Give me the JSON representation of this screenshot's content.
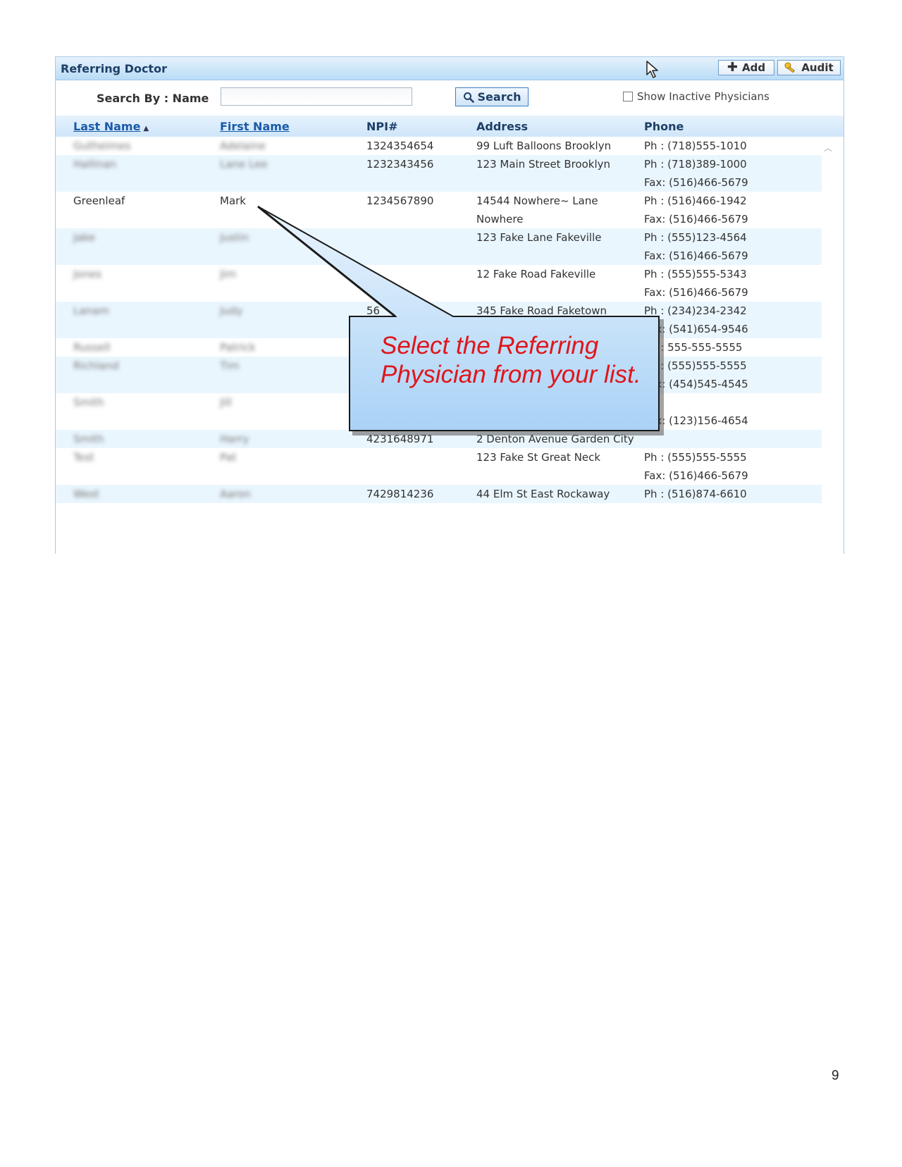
{
  "panel": {
    "title": "Referring Doctor",
    "add_label": "Add",
    "audit_label": "Audit"
  },
  "search": {
    "label": "Search By : Name",
    "value": "",
    "button_label": "Search",
    "inactive_label": "Show Inactive Physicians"
  },
  "table": {
    "headers": {
      "last_name": "Last Name",
      "first_name": "First Name",
      "npi": "NPI#",
      "address": "Address",
      "phone": "Phone"
    },
    "rows": [
      {
        "last": "Gutheimes",
        "first": "Adelaine",
        "npi": "1324354654",
        "address": [
          "99 Luft Balloons Brooklyn"
        ],
        "phone": [
          "Ph : (718)555-1010"
        ]
      },
      {
        "last": "Hallinan",
        "first": "Lane Lee",
        "npi": "1232343456",
        "address": [
          "123 Main Street Brooklyn"
        ],
        "phone": [
          "Ph : (718)389-1000",
          "Fax: (516)466-5679"
        ]
      },
      {
        "last": "Greenleaf",
        "first": "Mark",
        "npi": "1234567890",
        "address": [
          "14544 Nowhere~ Lane",
          "Nowhere"
        ],
        "phone": [
          "Ph : (516)466-1942",
          "Fax: (516)466-5679"
        ]
      },
      {
        "last": "Jake",
        "first": "Justin",
        "npi": "",
        "address": [
          "123 Fake Lane Fakeville"
        ],
        "phone": [
          "Ph : (555)123-4564",
          "Fax: (516)466-5679"
        ]
      },
      {
        "last": "Jones",
        "first": "Jim",
        "npi": "",
        "address": [
          "12 Fake Road Fakeville"
        ],
        "phone": [
          "Ph : (555)555-5343",
          "Fax: (516)466-5679"
        ]
      },
      {
        "last": "Lanam",
        "first": "Judy",
        "npi": "56",
        "address": [
          "345 Fake Road Faketown"
        ],
        "phone": [
          "Ph : (234)234-2342",
          "Fax: (541)654-9546"
        ]
      },
      {
        "last": "Russell",
        "first": "Patrick",
        "npi": "",
        "address": [
          ""
        ],
        "phone": [
          "Ph : 555-555-5555"
        ]
      },
      {
        "last": "Richland",
        "first": "Tim",
        "npi": "",
        "address": [
          ""
        ],
        "phone": [
          "Ph : (555)555-5555",
          "Fax: (454)545-4545"
        ]
      },
      {
        "last": "Smith",
        "first": "Jill",
        "npi": "",
        "address": [
          ""
        ],
        "phone": [
          "",
          "Fax: (123)156-4654"
        ]
      },
      {
        "last": "Smith",
        "first": "Harry",
        "npi": "4231648971",
        "address": [
          "2 Denton Avenue Garden City"
        ],
        "phone": [
          ""
        ]
      },
      {
        "last": "Test",
        "first": "Pat",
        "npi": "",
        "address": [
          "123 Fake St Great Neck"
        ],
        "phone": [
          "Ph : (555)555-5555",
          "Fax: (516)466-5679"
        ]
      },
      {
        "last": "West",
        "first": "Aaron",
        "npi": "7429814236",
        "address": [
          "44 Elm St East Rockaway"
        ],
        "phone": [
          "Ph : (516)874-6610"
        ]
      }
    ]
  },
  "callout": {
    "text": "Select the Referring Physician from your list."
  },
  "page_number": "9",
  "colors": {
    "title_bar": "#b9dcf6",
    "header_text": "#1e3f66",
    "callout_text": "#e0151a",
    "alt_row": "#eaf6fe"
  }
}
